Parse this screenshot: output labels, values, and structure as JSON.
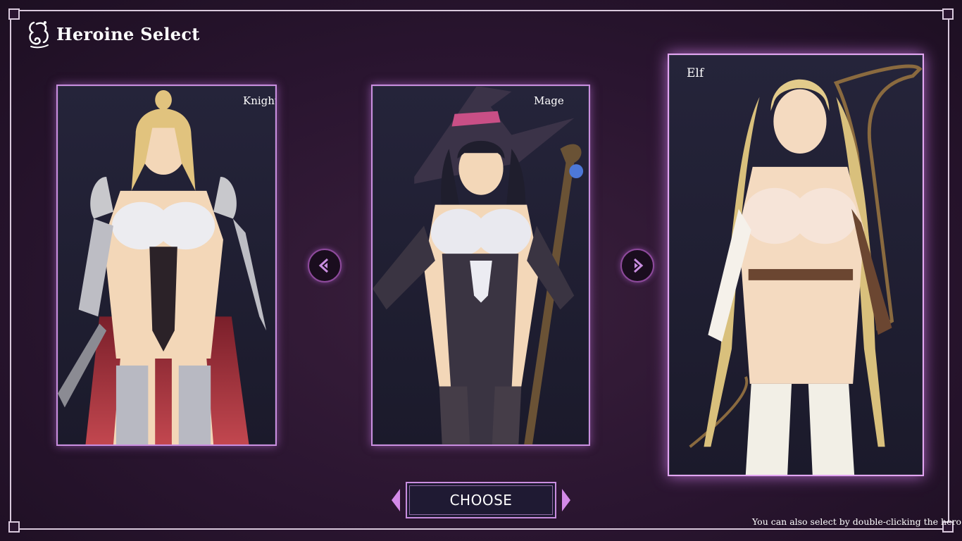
{
  "header": {
    "title": "Heroine Select",
    "icon": "heroine-emblem-icon"
  },
  "cards": [
    {
      "label": "Knight",
      "state": "unselected"
    },
    {
      "label": "Mage",
      "state": "unselected"
    },
    {
      "label": "Elf",
      "state": "selected"
    }
  ],
  "nav": {
    "prev_icon": "chevron-left-icon",
    "next_icon": "chevron-right-icon"
  },
  "footer": {
    "choose_label": "CHOOSE",
    "hint": "You can also select by double-clicking the hero"
  },
  "colors": {
    "accent": "#c98ee0",
    "background": "#2a1530",
    "frame": "#d9c9dc"
  }
}
